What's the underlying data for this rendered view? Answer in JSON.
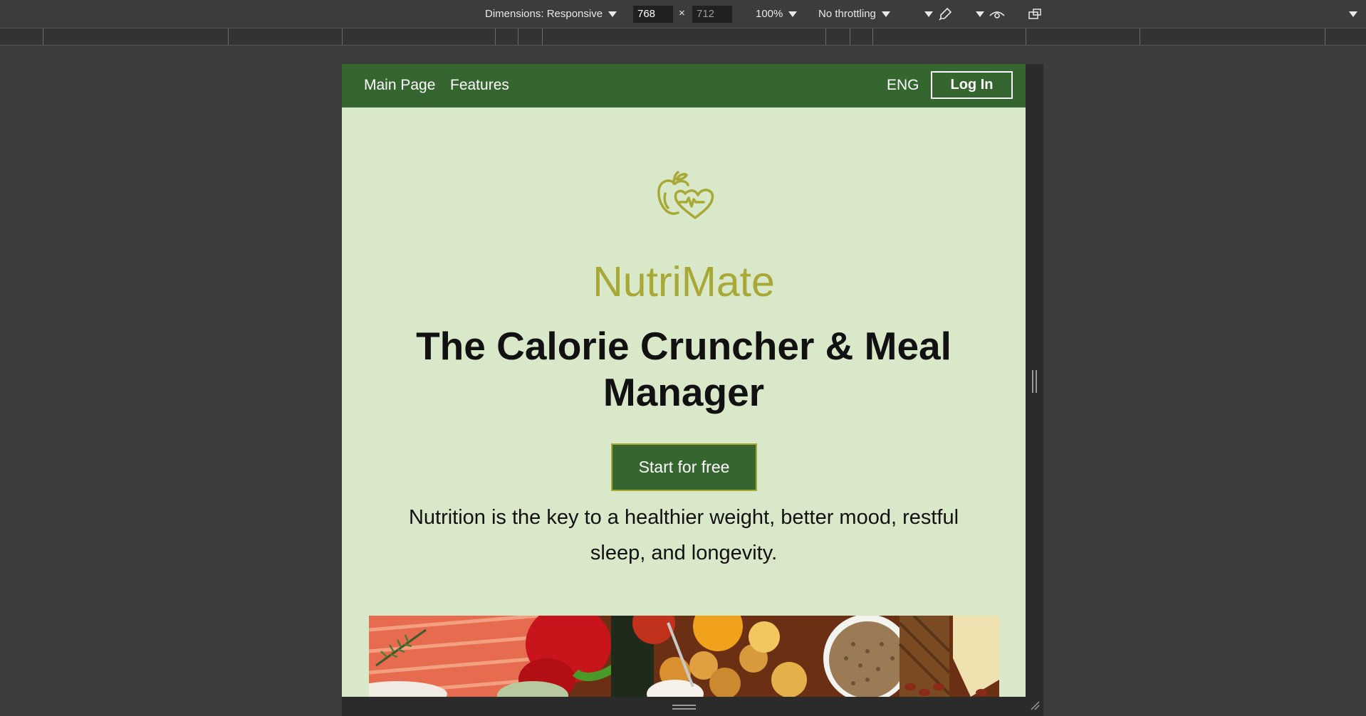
{
  "devtools": {
    "dimensions_label": "Dimensions: Responsive",
    "width_value": "768",
    "height_placeholder": "712",
    "times": "×",
    "zoom": "100%",
    "throttling": "No throttling"
  },
  "nav": {
    "main_page": "Main Page",
    "features": "Features",
    "lang": "ENG",
    "login": "Log In"
  },
  "hero": {
    "logo_icon": "apple-heart-icon",
    "brand": "NutriMate",
    "headline": "The Calorie Cruncher & Meal Manager",
    "cta": "Start for free",
    "tagline": "Nutrition is the key to a healthier weight, better mood, restful sleep, and longevity."
  },
  "colors": {
    "nav_green": "#356630",
    "page_bg": "#d9e8c9",
    "brand_olive": "#a7a835"
  }
}
